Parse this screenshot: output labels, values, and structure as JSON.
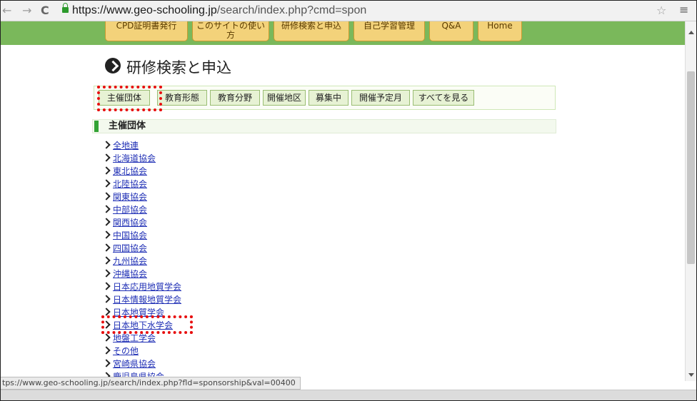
{
  "browser": {
    "back_glyph": "←",
    "forward_glyph": "→",
    "reload_glyph": "C",
    "url_host": "https://www.geo-schooling.jp",
    "url_path": "/search/index.php?cmd=spon",
    "star_glyph": "☆",
    "menu_glyph": "≡"
  },
  "top_nav": [
    "CPD証明書発行",
    "このサイトの使い方",
    "研修検索と申込",
    "自己学習管理",
    "Q&A",
    "Home"
  ],
  "page_title": "研修検索と申込",
  "tabs": [
    "主催団体",
    "教育形態",
    "教育分野",
    "開催地区",
    "募集中",
    "開催予定月",
    "すべてを見る"
  ],
  "section_title": "主催団体",
  "links": [
    "全地連",
    "北海道協会",
    "東北協会",
    "北陸協会",
    "関東協会",
    "中部協会",
    "関西協会",
    "中国協会",
    "四国協会",
    "九州協会",
    "沖縄協会",
    "日本応用地質学会",
    "日本情報地質学会",
    "日本地質学会",
    "日本地下水学会",
    "地盤工学会",
    "その他",
    "宮崎県協会",
    "鹿児島県協会"
  ],
  "status_url": "tps://www.geo-schooling.jp/search/index.php?fld=sponsorship&val=00400",
  "colors": {
    "header_green": "#7ab85b",
    "nav_tab": "#f3d27a",
    "link_blue": "#1f2fb5",
    "highlight_red": "#e81010"
  }
}
